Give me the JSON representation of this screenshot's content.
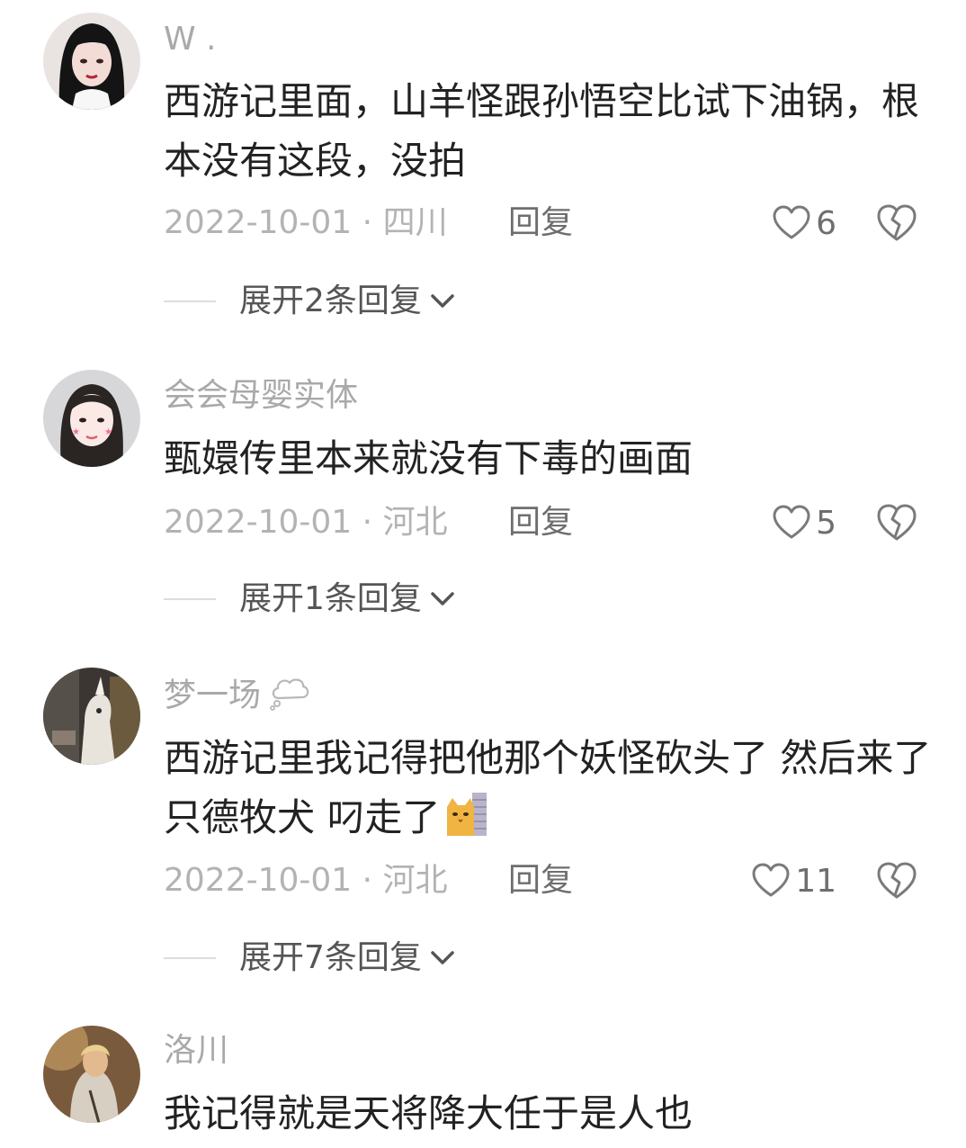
{
  "comments": [
    {
      "username": "W .",
      "text": "西游记里面，山羊怪跟孙悟空比试下油锅，根本没有这段，没拍",
      "date": "2022-10-01",
      "location": "四川",
      "reply_label": "回复",
      "likes": "6",
      "expand_label": "展开2条回复"
    },
    {
      "username": "会会母婴实体",
      "text": "甄嬛传里本来就没有下毒的画面",
      "date": "2022-10-01",
      "location": "河北",
      "reply_label": "回复",
      "likes": "5",
      "expand_label": "展开1条回复"
    },
    {
      "username": "梦一场",
      "text": "西游记里我记得把他那个妖怪砍头了 然后来了只德牧犬 叼走了",
      "date": "2022-10-01",
      "location": "河北",
      "reply_label": "回复",
      "likes": "11",
      "expand_label": "展开7条回复"
    },
    {
      "username": "洛川",
      "text": "我记得就是天将降大任于是人也"
    }
  ],
  "meta_separator": "·",
  "icons": {
    "like": "heart-outline-icon",
    "dislike": "broken-heart-icon",
    "expand": "chevron-down-icon",
    "username_badge": "thought-cloud-icon",
    "emoji": "cat-peeking-emoji"
  }
}
